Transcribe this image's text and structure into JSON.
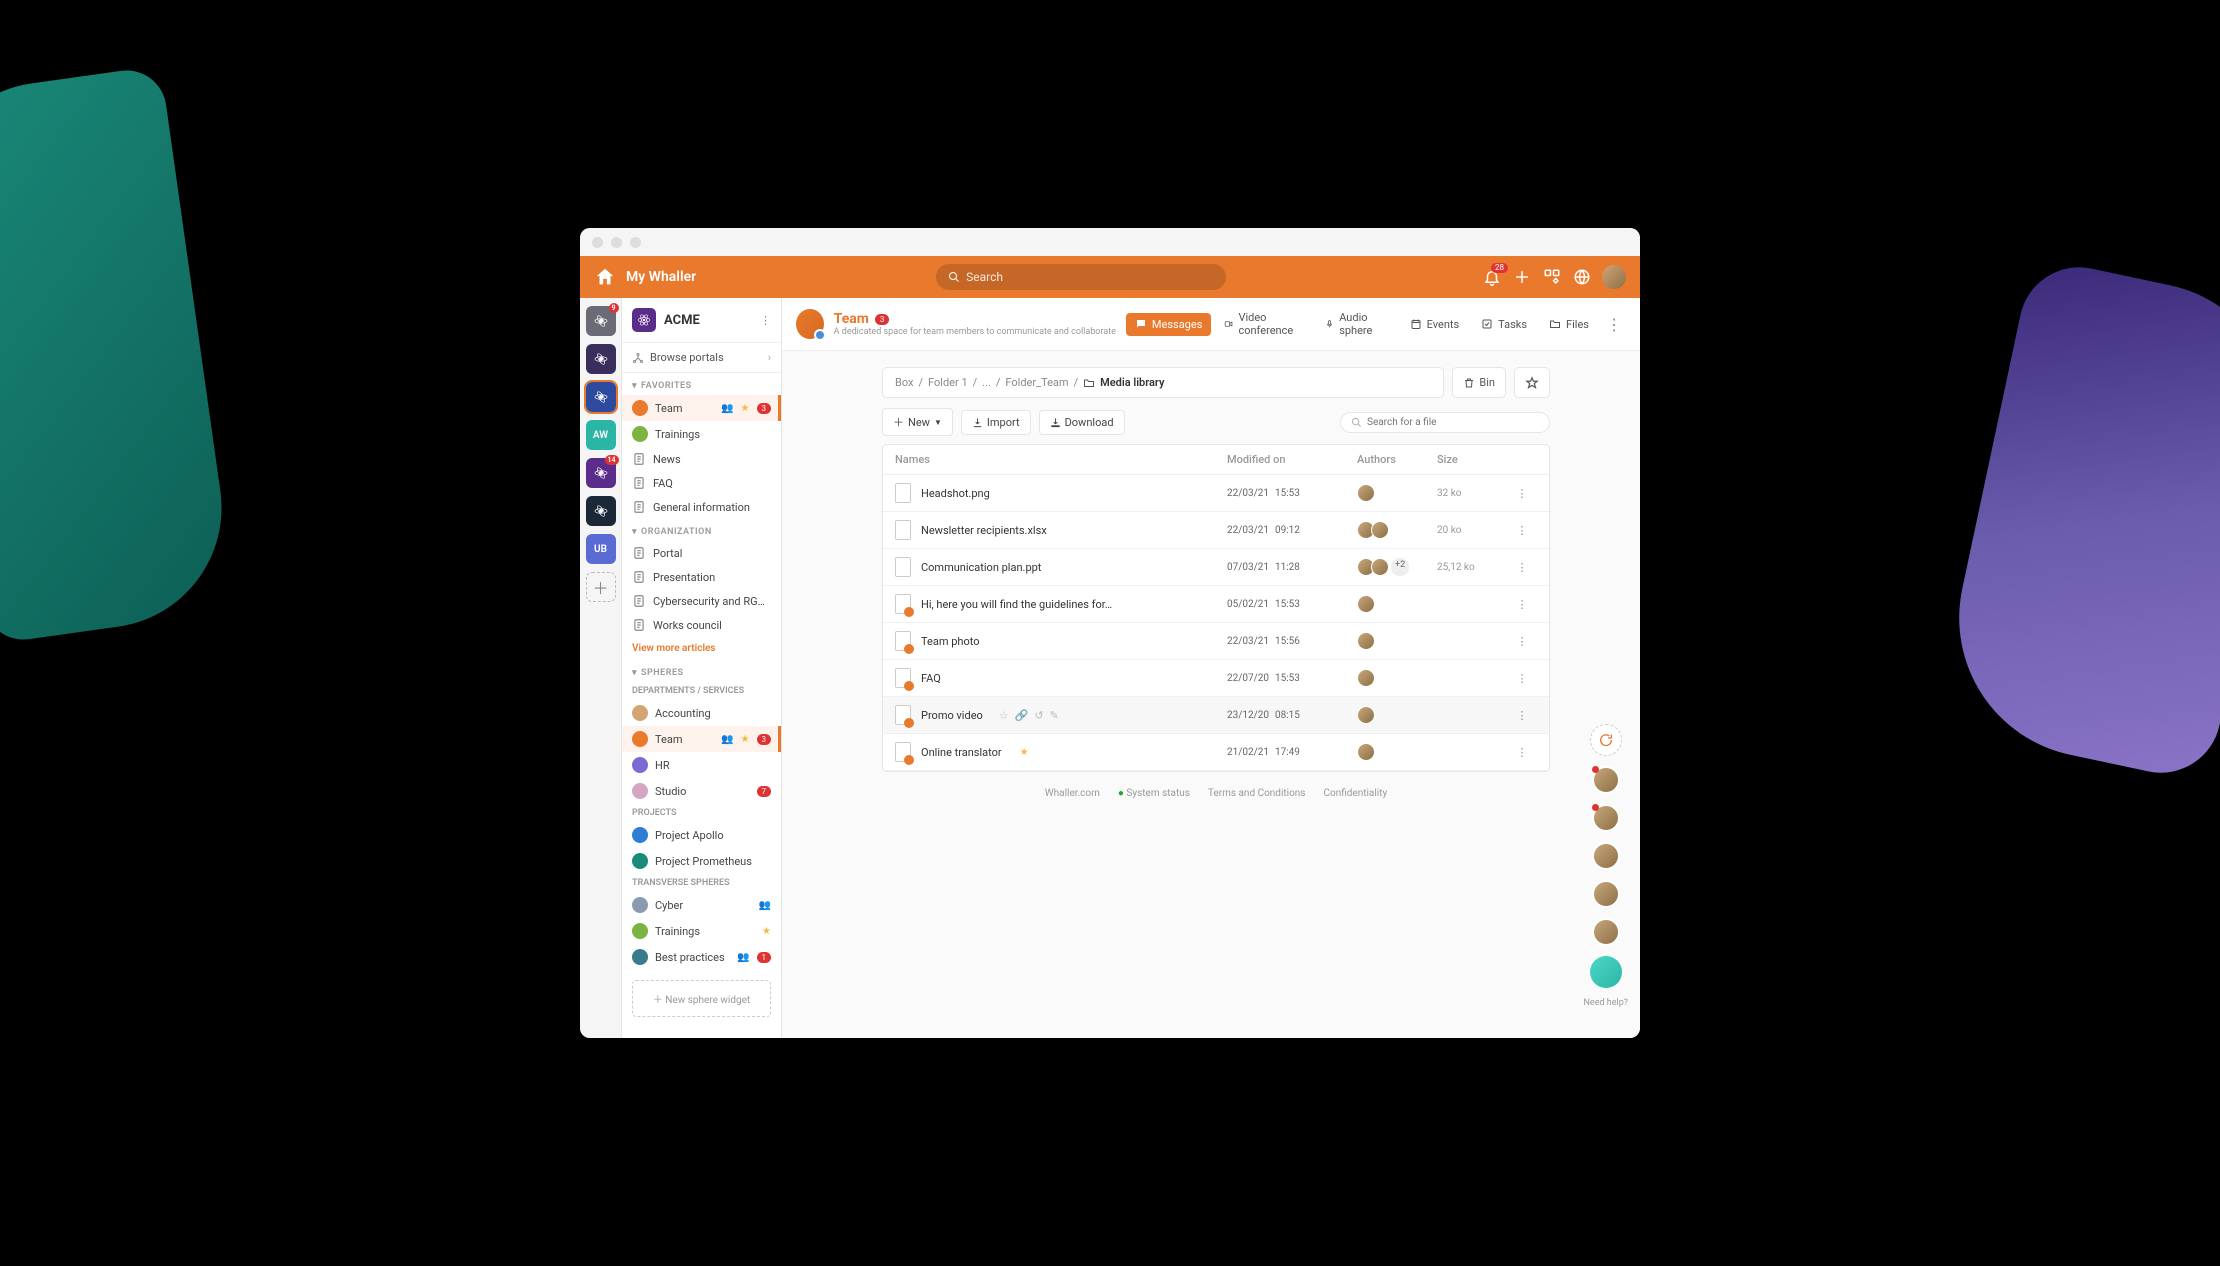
{
  "brand": "My Whaller",
  "search": {
    "placeholder": "Search"
  },
  "notifications": {
    "count": "28"
  },
  "rail": [
    {
      "bg": "#6b6b78",
      "badge": "9"
    },
    {
      "bg": "#3a2e5c"
    },
    {
      "bg": "#2d4a9e",
      "active": true
    },
    {
      "bg": "#2ab5a5",
      "text": "AW"
    },
    {
      "bg": "#5b2d8a",
      "badge": "14"
    },
    {
      "bg": "#1a2838"
    },
    {
      "bg": "#5b6bd4",
      "text": "UB",
      "badge": ""
    }
  ],
  "org": {
    "name": "ACME"
  },
  "browse": "Browse portals",
  "sections": {
    "favorites": "FAVORITES",
    "organization": "ORGANIZATION",
    "spheres": "SPHERES",
    "projects": "PROJECTS",
    "transverse": "TRANSVERSE SPHERES",
    "departments": "DEPARTMENTS / SERVICES"
  },
  "favorites": [
    {
      "label": "Team",
      "color": "#e8792d",
      "star": true,
      "icon": true,
      "badge": "3",
      "active": true
    },
    {
      "label": "Trainings",
      "color": "#7cb342"
    },
    {
      "label": "News",
      "doc": true
    },
    {
      "label": "FAQ",
      "doc": true
    },
    {
      "label": "General information",
      "doc": true
    }
  ],
  "organization": [
    {
      "label": "Portal"
    },
    {
      "label": "Presentation"
    },
    {
      "label": "Cybersecurity and RGPD"
    },
    {
      "label": "Works council"
    }
  ],
  "more_articles": "View more articles",
  "departments": [
    {
      "label": "Accounting",
      "color": "#d4a574"
    },
    {
      "label": "Team",
      "color": "#e8792d",
      "star": true,
      "icon": true,
      "badge": "3",
      "active": true
    },
    {
      "label": "HR",
      "color": "#7a6bd4"
    },
    {
      "label": "Studio",
      "color": "#d4a5c4",
      "badge": "7"
    }
  ],
  "projects": [
    {
      "label": "Project Apollo",
      "color": "#2d7dd2"
    },
    {
      "label": "Project Prometheus",
      "color": "#1a8a7a"
    }
  ],
  "transverse": [
    {
      "label": "Cyber",
      "color": "#8a9bb0",
      "icon": true
    },
    {
      "label": "Trainings",
      "color": "#7cb342",
      "star": true
    },
    {
      "label": "Best practices",
      "color": "#3a7a8a",
      "icon": true,
      "badge": "1"
    }
  ],
  "new_widget": "New sphere widget",
  "sphere": {
    "title": "Team",
    "badge": "3",
    "subtitle": "A dedicated space for team members to communicate and collaborate"
  },
  "tabs": {
    "messages": "Messages",
    "video": "Video conference",
    "audio": "Audio sphere",
    "events": "Events",
    "tasks": "Tasks",
    "files": "Files"
  },
  "breadcrumb": {
    "parts": [
      "Box",
      "Folder 1",
      "...",
      "Folder_Team"
    ],
    "current": "Media library"
  },
  "bin": "Bin",
  "toolbar": {
    "new": "New",
    "import": "Import",
    "download": "Download"
  },
  "file_search": {
    "placeholder": "Search for a file"
  },
  "columns": {
    "name": "Names",
    "modified": "Modified on",
    "authors": "Authors",
    "size": "Size"
  },
  "files": [
    {
      "name": "Headshot.png",
      "date": "22/03/21",
      "time": "15:53",
      "authors": 1,
      "size": "32 ko"
    },
    {
      "name": "Newsletter recipients.xlsx",
      "date": "22/03/21",
      "time": "09:12",
      "authors": 2,
      "size": "20 ko"
    },
    {
      "name": "Communication plan.ppt",
      "date": "07/03/21",
      "time": "11:28",
      "authors": 2,
      "more": "+2",
      "size": "25,12 ko"
    },
    {
      "name": "Hi, here you will find the guidelines for…",
      "date": "05/02/21",
      "time": "15:53",
      "authors": 1,
      "size": "",
      "shared": true
    },
    {
      "name": "Team photo",
      "date": "22/03/21",
      "time": "15:56",
      "authors": 1,
      "size": "",
      "shared": true
    },
    {
      "name": "FAQ",
      "date": "22/07/20",
      "time": "15:53",
      "authors": 1,
      "size": "",
      "shared": true
    },
    {
      "name": "Promo video",
      "date": "23/12/20",
      "time": "08:15",
      "authors": 1,
      "size": "",
      "shared": true,
      "selected": true,
      "actions": true
    },
    {
      "name": "Online translator",
      "date": "21/02/21",
      "time": "17:49",
      "authors": 1,
      "size": "",
      "shared": true,
      "star": true
    }
  ],
  "footer": {
    "site": "Whaller.com",
    "status": "System status",
    "terms": "Terms and Conditions",
    "confidentiality": "Confidentiality"
  },
  "help": "Need help?"
}
